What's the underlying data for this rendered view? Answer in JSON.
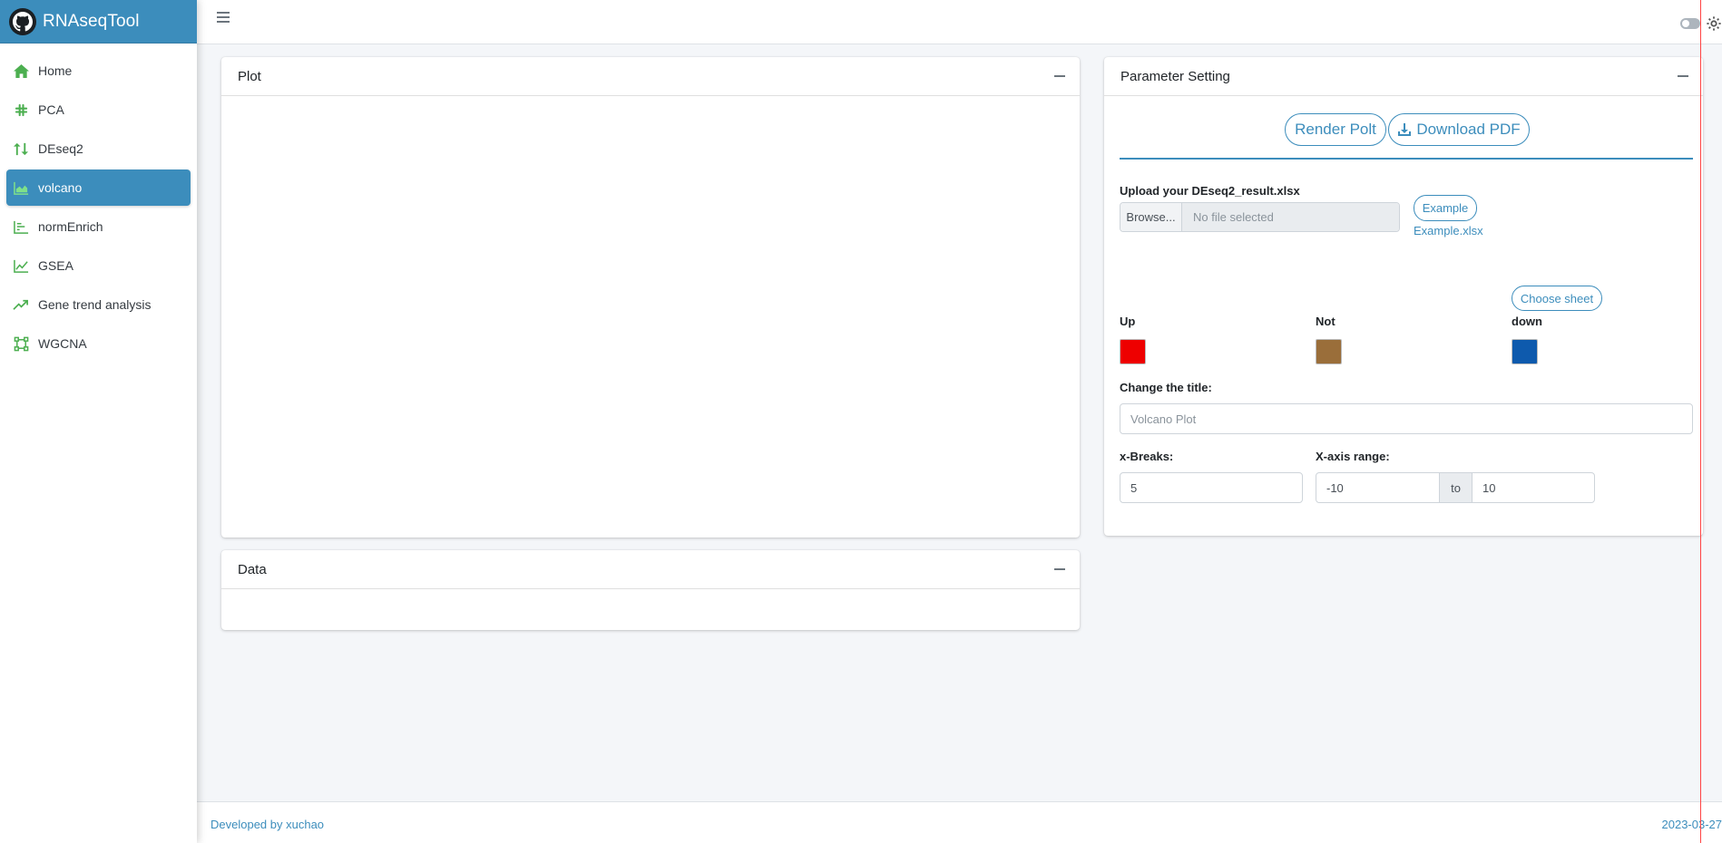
{
  "app": {
    "title": "RNAseqTool"
  },
  "sidebar": {
    "items": [
      {
        "label": "Home",
        "icon": "home-icon"
      },
      {
        "label": "PCA",
        "icon": "slack-icon"
      },
      {
        "label": "DEseq2",
        "icon": "sort-arrows-icon"
      },
      {
        "label": "volcano",
        "icon": "area-chart-icon",
        "active": true
      },
      {
        "label": "normEnrich",
        "icon": "bar-chart-icon"
      },
      {
        "label": "GSEA",
        "icon": "line-chart-icon"
      },
      {
        "label": "Gene trend analysis",
        "icon": "trend-up-icon"
      },
      {
        "label": "WGCNA",
        "icon": "vector-square-icon"
      }
    ]
  },
  "cards": {
    "plot_title": "Plot",
    "data_title": "Data",
    "param_title": "Parameter Setting"
  },
  "params": {
    "render_label": "Render Polt",
    "download_label": "Download PDF",
    "upload_label": "Upload your DEseq2_result.xlsx",
    "browse_label": "Browse...",
    "file_placeholder": "No file selected",
    "example_button": "Example",
    "example_link": "Example.xlsx",
    "choose_sheet": "Choose sheet",
    "up_label": "Up",
    "not_label": "Not",
    "down_label": "down",
    "up_color": "#ee0000",
    "not_color": "#9a6e3a",
    "down_color": "#0e5aad",
    "title_label": "Change the title:",
    "title_placeholder": "Volcano Plot",
    "xbreaks_label": "x-Breaks:",
    "xbreaks_value": "5",
    "xrange_label": "X-axis range:",
    "xrange_min": "-10",
    "xrange_sep": "to",
    "xrange_max": "10"
  },
  "footer": {
    "left": "Developed by xuchao",
    "right": "2023-03-27"
  },
  "colors": {
    "accent": "#3c8dbc",
    "icon_green": "#4caf50"
  }
}
